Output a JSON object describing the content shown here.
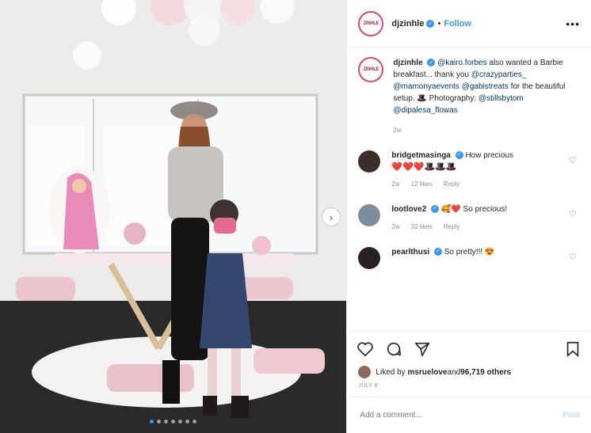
{
  "post": {
    "username": "djzinhle",
    "avatar_text": "ZINHLE",
    "follow_label": "Follow",
    "separator": "•",
    "more_label": "•••",
    "caption": {
      "username": "djzinhle",
      "parts": [
        {
          "text": "@kairo.forbes",
          "mention": true
        },
        {
          "text": " also wanted a Barbie breakfast... thank you ",
          "mention": false
        },
        {
          "text": "@crazyparties_",
          "mention": true
        },
        {
          "text": " ",
          "mention": false
        },
        {
          "text": "@mamonyaevents",
          "mention": true
        },
        {
          "text": " ",
          "mention": false
        },
        {
          "text": "@gabistreats",
          "mention": true
        },
        {
          "text": " for the beautiful setup. 🎩 Photography: ",
          "mention": false
        },
        {
          "text": "@stillsbytom",
          "mention": true
        },
        {
          "text": " ",
          "mention": false
        },
        {
          "text": "@dipalesa_flowas",
          "mention": true
        }
      ],
      "time": "2w"
    },
    "comments": [
      {
        "username": "bridgetmasinga",
        "verified": true,
        "text": "How precious",
        "emoji_line": "❤️❤️❤️🎩🎩🎩",
        "time": "2w",
        "likes": "12 likes",
        "reply": "Reply",
        "avatar_color": "#3a2f2b"
      },
      {
        "username": "lootlove2",
        "verified": true,
        "text": "🥰❤️ So precious!",
        "emoji_line": "",
        "time": "2w",
        "likes": "32 likes",
        "reply": "Reply",
        "avatar_color": "#7c8da0"
      },
      {
        "username": "pearlthusi",
        "verified": true,
        "text": "So pretty!!! 😍",
        "emoji_line": "",
        "time": "",
        "likes": "",
        "reply": "",
        "avatar_color": "#2a2220"
      }
    ],
    "likes_text_prefix": "Liked by ",
    "likes_user": "msruelove",
    "likes_text_mid": " and ",
    "likes_count": "96,719 others",
    "date": "JULY 8",
    "comment_placeholder": "Add a comment...",
    "post_button": "Post",
    "carousel": {
      "count": 7,
      "active": 0
    },
    "colors": {
      "accent": "#3897f0",
      "ring": "#e94374"
    }
  }
}
